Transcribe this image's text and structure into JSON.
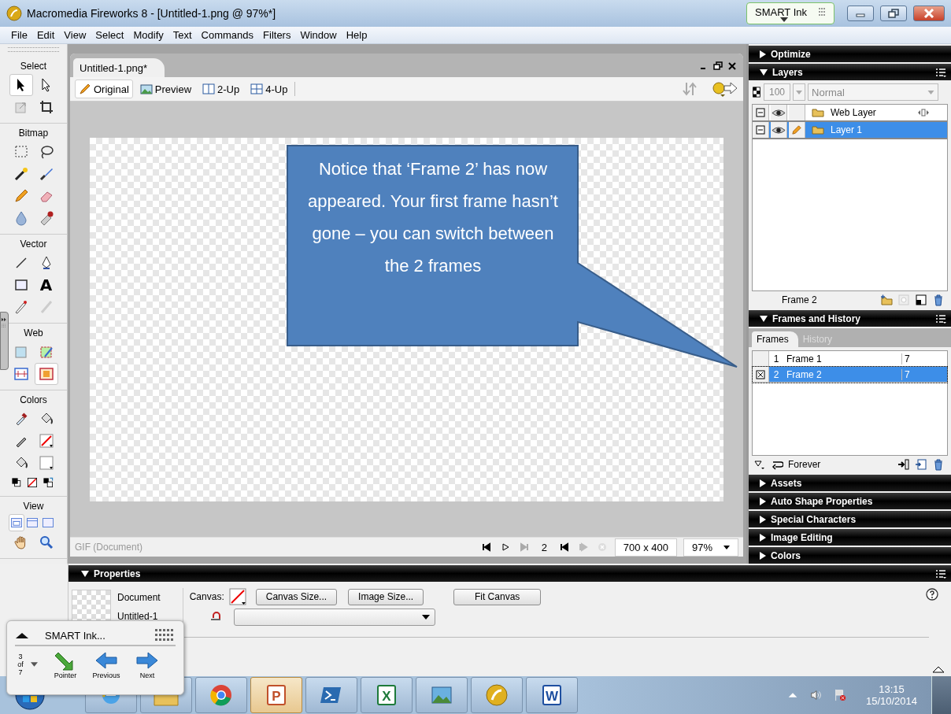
{
  "window": {
    "title": "Macromedia Fireworks 8 - [Untitled-1.png @  97%*]"
  },
  "smart_ink_badge": {
    "label": "SMART Ink"
  },
  "menu": [
    "File",
    "Edit",
    "View",
    "Select",
    "Modify",
    "Text",
    "Commands",
    "Filters",
    "Window",
    "Help"
  ],
  "tools_panel": {
    "sections": [
      {
        "title": "Select",
        "tools": [
          {
            "selected": true
          },
          {
            "selected": false
          },
          {
            "selected": false
          },
          {
            "selected": false
          }
        ]
      },
      {
        "title": "Bitmap",
        "tools": [
          {
            "selected": false
          },
          {
            "selected": false
          },
          {
            "selected": false
          },
          {
            "selected": false
          },
          {
            "selected": false
          },
          {
            "selected": false
          },
          {
            "selected": false
          },
          {
            "selected": false
          }
        ]
      },
      {
        "title": "Vector",
        "tools": [
          {
            "selected": false
          },
          {
            "selected": false
          },
          {
            "selected": false
          },
          {
            "selected": false,
            "glyph": "A"
          },
          {
            "selected": false
          },
          {
            "selected": false
          }
        ]
      },
      {
        "title": "Web",
        "tools": [
          {
            "selected": false
          },
          {
            "selected": false
          },
          {
            "selected": false
          },
          {
            "selected": true
          }
        ]
      },
      {
        "title": "Colors",
        "tools": [
          {
            "selected": false
          },
          {
            "selected": false
          },
          {
            "selected": false
          },
          {
            "selected": false
          },
          {
            "selected": false
          },
          {
            "selected": false
          },
          {
            "selected": false
          },
          {
            "selected": false
          },
          {
            "selected": false
          }
        ]
      },
      {
        "title": "View",
        "tools": [
          {
            "selected": true
          },
          {
            "selected": false
          },
          {
            "selected": false
          },
          {
            "selected": false
          },
          {
            "selected": false
          }
        ]
      }
    ]
  },
  "document": {
    "tab": "Untitled-1.png*",
    "views": [
      {
        "label": "Original",
        "selected": true
      },
      {
        "label": "Preview",
        "selected": false
      },
      {
        "label": "2-Up",
        "selected": false
      },
      {
        "label": "4-Up",
        "selected": false
      }
    ],
    "callout": "Notice that ‘Frame 2’ has now appeared. Your first frame hasn’t gone – you can switch between the 2 frames",
    "status": {
      "format": "GIF (Document)",
      "frame": "2",
      "size": "700 x 400",
      "zoom": "97%"
    }
  },
  "panels": [
    {
      "title": "Optimize",
      "expanded": false
    },
    {
      "title": "Layers",
      "kind": "layers",
      "expanded": true
    },
    {
      "title": "Frames and History",
      "kind": "frames",
      "expanded": true
    },
    {
      "title": "Assets",
      "expanded": false
    },
    {
      "title": "Auto Shape Properties",
      "expanded": false
    },
    {
      "title": "Special Characters",
      "expanded": false
    },
    {
      "title": "Image Editing",
      "expanded": false
    },
    {
      "title": "Colors",
      "expanded": false
    }
  ],
  "layers": {
    "opacity": "100",
    "blend_mode": "Normal",
    "items": [
      {
        "name": "Web Layer",
        "kind": "web",
        "visible": true,
        "selected": false
      },
      {
        "name": "Layer 1",
        "kind": "layer",
        "visible": true,
        "selected": true
      }
    ],
    "footer": "Frame 2"
  },
  "frames": {
    "tabs": [
      {
        "label": "Frames",
        "selected": true
      },
      {
        "label": "History",
        "selected": false
      }
    ],
    "items": [
      {
        "number": "1",
        "name": "Frame 1",
        "delay": "7",
        "selected": false
      },
      {
        "number": "2",
        "name": "Frame 2",
        "delay": "7",
        "selected": true
      }
    ],
    "loop": "Forever"
  },
  "properties": {
    "title": "Properties",
    "type": "Document",
    "name": "Untitled-1",
    "canvas_label": "Canvas:",
    "buttons": [
      "Canvas Size...",
      "Image Size...",
      "Fit Canvas"
    ]
  },
  "smart_ink_toolbar": {
    "title": "SMART Ink...",
    "page": "3",
    "of": "of",
    "total": "7",
    "buttons": [
      {
        "label": "Pointer",
        "kind": "pointer"
      },
      {
        "label": "Previous",
        "kind": "previous"
      },
      {
        "label": "Next",
        "kind": "next"
      }
    ]
  },
  "taskbar": {
    "apps": [
      {
        "kind": "browser",
        "active": false
      },
      {
        "kind": "folder",
        "active": false
      },
      {
        "kind": "chrome",
        "active": false
      },
      {
        "kind": "presentation",
        "glyph": "P",
        "active": true
      },
      {
        "kind": "terminal",
        "active": false
      },
      {
        "kind": "spreadsheet",
        "glyph": "X",
        "active": false
      },
      {
        "kind": "pictures",
        "active": false
      },
      {
        "kind": "graphics",
        "active": false
      },
      {
        "kind": "document",
        "glyph": "W",
        "active": false
      }
    ],
    "time": "13:15",
    "date": "15/10/2014"
  }
}
